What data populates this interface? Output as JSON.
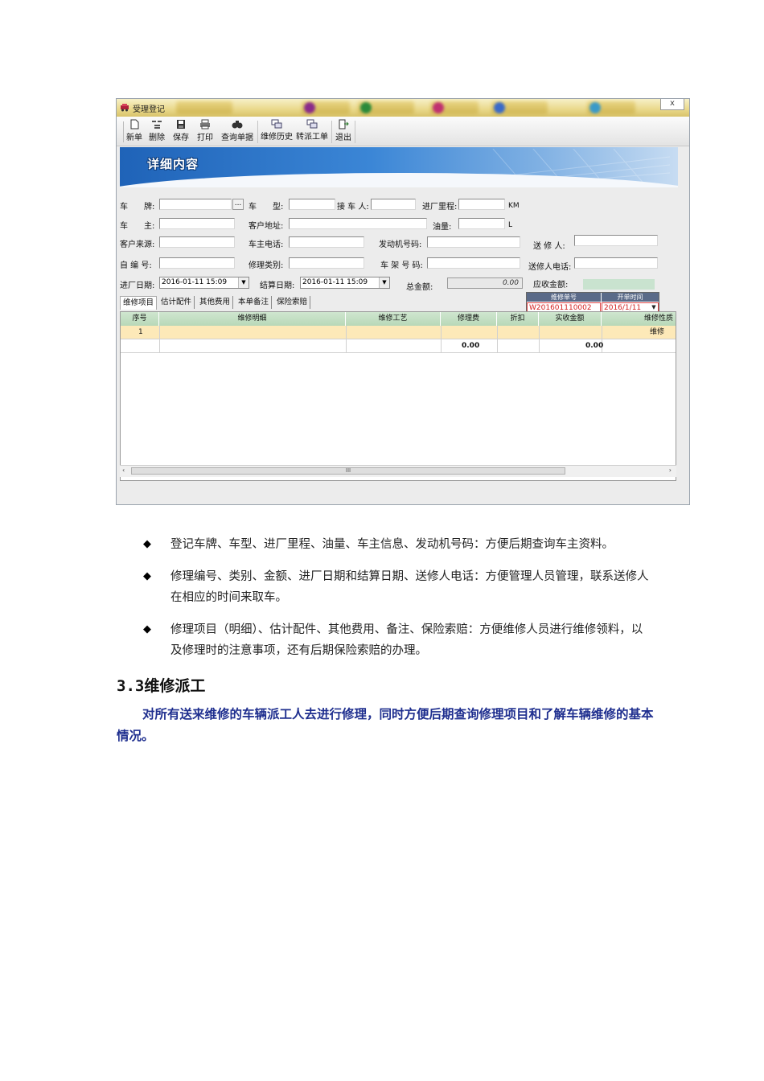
{
  "window": {
    "title": "受理登记",
    "close_label": "x"
  },
  "toolbar": {
    "new": "新单",
    "delete": "删除",
    "save": "保存",
    "print": "打印",
    "query": "查询单据",
    "history": "维修历史",
    "transfer": "转派工单",
    "exit": "退出"
  },
  "banner": {
    "label": "详细内容"
  },
  "form": {
    "plate_label": "车　　牌:",
    "plate_btn": "...",
    "car_type_label": "车　　型:",
    "receiver_label": "接 车 人:",
    "mileage_label": "进厂里程:",
    "mileage_unit": "KM",
    "owner_label": "车　　主:",
    "address_label": "客户地址:",
    "oil_label": "油量:",
    "oil_unit": "L",
    "source_label": "客户来源:",
    "owner_phone_label": "车主电话:",
    "engine_label": "发动机号码:",
    "sender_label": "送 修 人:",
    "self_no_label": "自 编 号:",
    "repair_type_label": "修理类别:",
    "frame_label": "车 架 号 码:",
    "sender_phone_label": "送修人电话:",
    "in_date_label": "进厂日期:",
    "in_date_value": "2016-01-11 15:09",
    "settle_date_label": "结算日期:",
    "settle_date_value": "2016-01-11 15:09",
    "total_label": "总金额:",
    "total_value": "0.00",
    "receivable_label": "应收金额:"
  },
  "order_box": {
    "order_no_header": "维修单号",
    "open_time_header": "开单时间",
    "order_no": "W201601110002",
    "open_time": "2016/1/11"
  },
  "tabs": [
    "维修项目",
    "估计配件",
    "其他费用",
    "本单备注",
    "保险索赔"
  ],
  "grid": {
    "columns": [
      "序号",
      "维修明细",
      "维修工艺",
      "修理费",
      "折扣",
      "实收金额",
      "维修性质"
    ],
    "row1": {
      "index": "1",
      "nature": "维修"
    },
    "totals": {
      "repair_fee": "0.00",
      "actual": "0.00"
    },
    "scroll_thumb": "III"
  },
  "bullets": [
    "登记车牌、车型、进厂里程、油量、车主信息、发动机号码：方便后期查询车主资料。",
    "修理编号、类别、金额、进厂日期和结算日期、送修人电话：方便管理人员管理，联系送修人在相应的时间来取车。",
    "修理项目（明细）、估计配件、其他费用、备注、保险索赔：方便维修人员进行维修领料，以及修理时的注意事项，还有后期保险索赔的办理。"
  ],
  "bullet_symbol": "◆",
  "section": {
    "heading": "3.3维修派工",
    "paragraph": "对所有送来维修的车辆派工人去进行修理，同时方便后期查询修理项目和了解车辆维修的基本情况。"
  },
  "colors": {
    "banner_blue": "#1f63b8",
    "grid_header_green": "#b8d8b8",
    "row_highlight": "#fde9b8",
    "order_red": "#d42020",
    "paragraph_blue": "#1f2f8f"
  }
}
